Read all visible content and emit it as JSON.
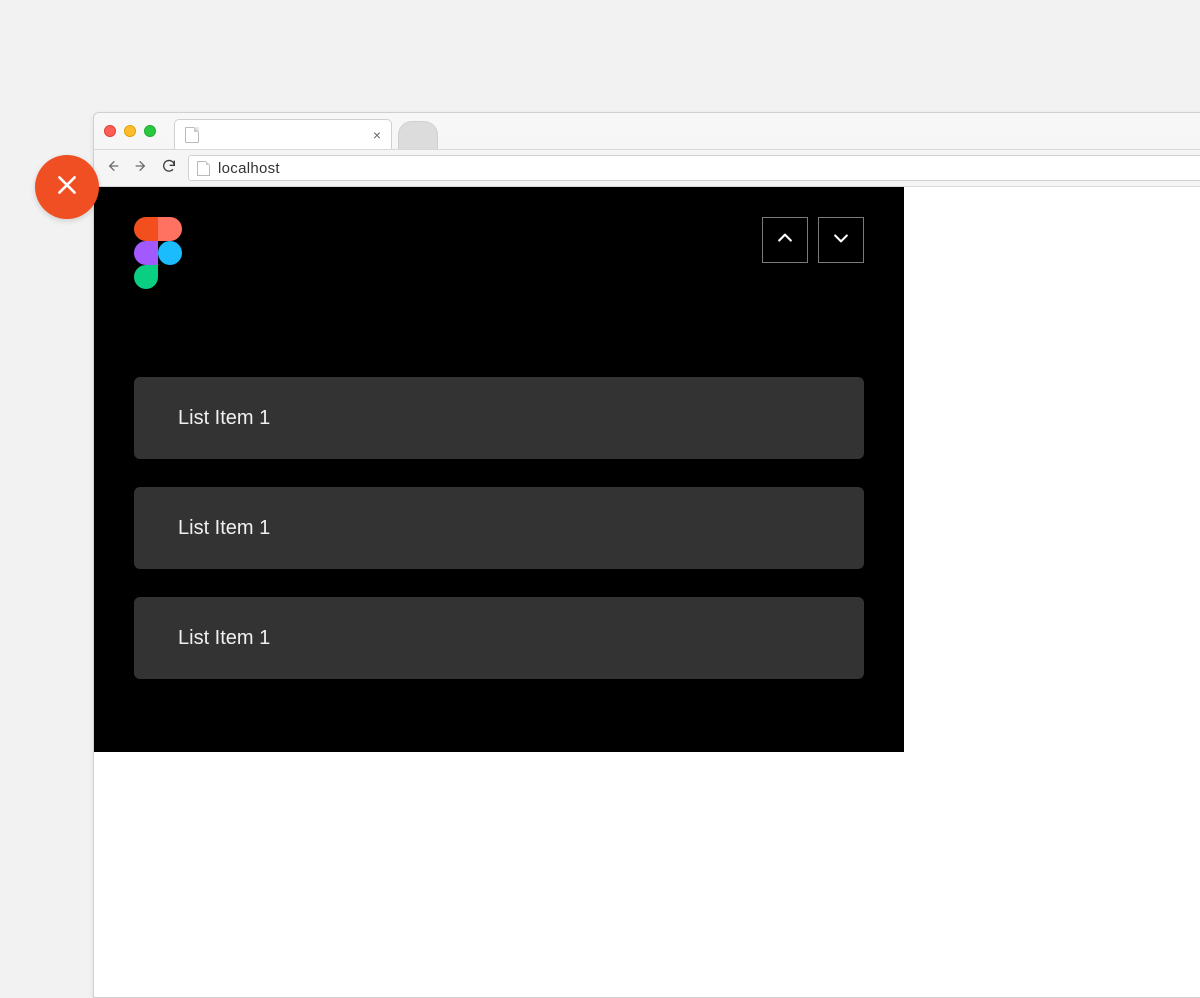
{
  "browser": {
    "address": "localhost",
    "tab_title": ""
  },
  "panel": {
    "list_items": [
      {
        "label": "List Item 1"
      },
      {
        "label": "List Item 1"
      },
      {
        "label": "List Item 1"
      }
    ]
  },
  "icons": {
    "close_badge": "close-icon",
    "up": "chevron-up-icon",
    "down": "chevron-down-icon",
    "back": "arrow-left-icon",
    "forward": "arrow-right-icon",
    "reload": "reload-icon",
    "logo": "figma-logo"
  },
  "colors": {
    "badge": "#f04e23",
    "panel_bg": "#000000",
    "item_bg": "#333333"
  }
}
